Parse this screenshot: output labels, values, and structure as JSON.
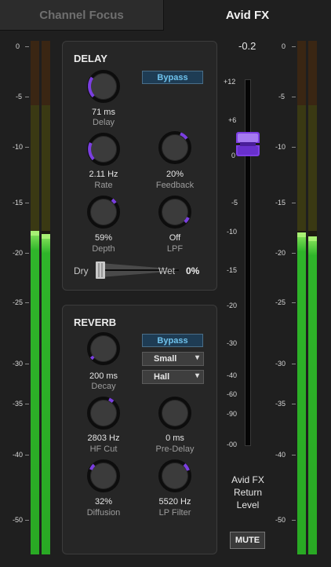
{
  "tabs": [
    {
      "label": "Channel Focus",
      "active": false
    },
    {
      "label": "Avid FX",
      "active": true
    }
  ],
  "meter_scale": [
    "0",
    "-5",
    "-10",
    "-15",
    "-20",
    "-25",
    "-30",
    "-35",
    "-40",
    "-50"
  ],
  "meters": {
    "left": {
      "channel_levels_fraction": [
        0.63,
        0.625
      ]
    },
    "right": {
      "channel_levels_fraction": [
        0.63,
        0.625
      ]
    }
  },
  "delay": {
    "title": "DELAY",
    "bypass_label": "Bypass",
    "knobs": [
      {
        "value": "71 ms",
        "label": "Delay"
      },
      {
        "value": "2.11 Hz",
        "label": "Rate"
      },
      {
        "value": "20%",
        "label": "Feedback"
      },
      {
        "value": "59%",
        "label": "Depth"
      },
      {
        "value": "Off",
        "label": "LPF"
      }
    ],
    "mix": {
      "dry_label": "Dry",
      "wet_label": "Wet",
      "value": "0%"
    }
  },
  "reverb": {
    "title": "REVERB",
    "bypass_label": "Bypass",
    "size_select": "Small",
    "type_select": "Hall",
    "knobs": [
      {
        "value": "200 ms",
        "label": "Decay"
      },
      {
        "value": "2803 Hz",
        "label": "HF Cut"
      },
      {
        "value": "0 ms",
        "label": "Pre-Delay"
      },
      {
        "value": "32%",
        "label": "Diffusion"
      },
      {
        "value": "5520 Hz",
        "label": "LP Filter"
      }
    ]
  },
  "fader": {
    "readout": "-0.2",
    "scale": [
      "+12",
      "+6",
      "0",
      "-5",
      "-10",
      "-15",
      "-20",
      "-30",
      "-40",
      "-60",
      "-90",
      "-00"
    ]
  },
  "return_label": "Avid FX\nReturn\nLevel",
  "mute_label": "MUTE",
  "colors": {
    "accent": "#7b3fe0",
    "bypass_text": "#6fc2ec",
    "meter_green": "#2fb52a",
    "meter_peak": "#a7f074"
  }
}
